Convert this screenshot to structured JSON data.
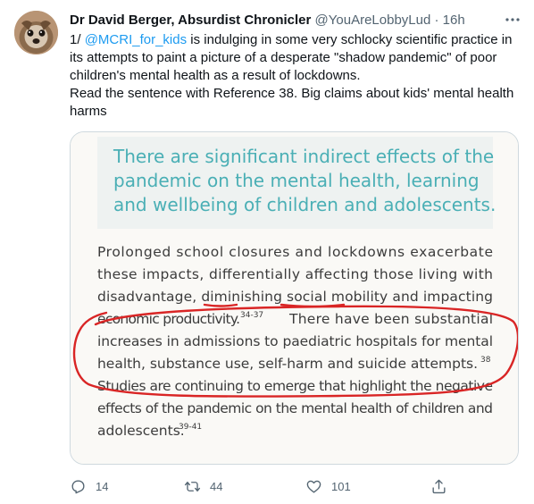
{
  "tweet": {
    "display_name": "Dr David Berger, Absurdist Chronicler",
    "handle": "@YouAreLobbyLud",
    "separator": "·",
    "time": "16h",
    "text_prefix": "1/",
    "mention": "@MCRI_for_kids",
    "text_line1_rest": "is indulging in some very schlocky scientific practice in its attempts to paint a picture of a desperate \"shadow pandemic\" of poor children's mental health as a result of lockdowns.",
    "text_line2": "Read the sentence with Reference 38. Big claims about kids' mental health harms"
  },
  "media": {
    "heading_lines": [
      "There are significant indirect effects of the",
      "pandemic on the mental health, learning",
      "and wellbeing of children and adolescents."
    ],
    "body_lines": [
      "Prolonged school closures and lockdowns exacerbate",
      "these impacts, differentially affecting those living with",
      "disadvantage, diminishing social mobility and impacting",
      "economic productivity.",
      "There have been substantial",
      "increases in admissions to paediatric hospitals for mental",
      "health, substance use, self-harm and suicide attempts.",
      "Studies are continuing to emerge that highlight the negative",
      "effects of the pandemic on the mental health of children and",
      "adolescents."
    ],
    "ref_34_37": "34-37",
    "ref_38": "38",
    "ref_39_41": "39-41",
    "heading_color": "#4aafb5",
    "heading_bg": "#eef2f1",
    "body_color": "#3c3c3c",
    "annotation_color": "#d92525"
  },
  "actions": {
    "reply_count": "14",
    "retweet_count": "44",
    "like_count": "101"
  },
  "colors": {
    "link": "#1d9bf0",
    "secondary": "#536471",
    "border": "#cfd9de"
  }
}
